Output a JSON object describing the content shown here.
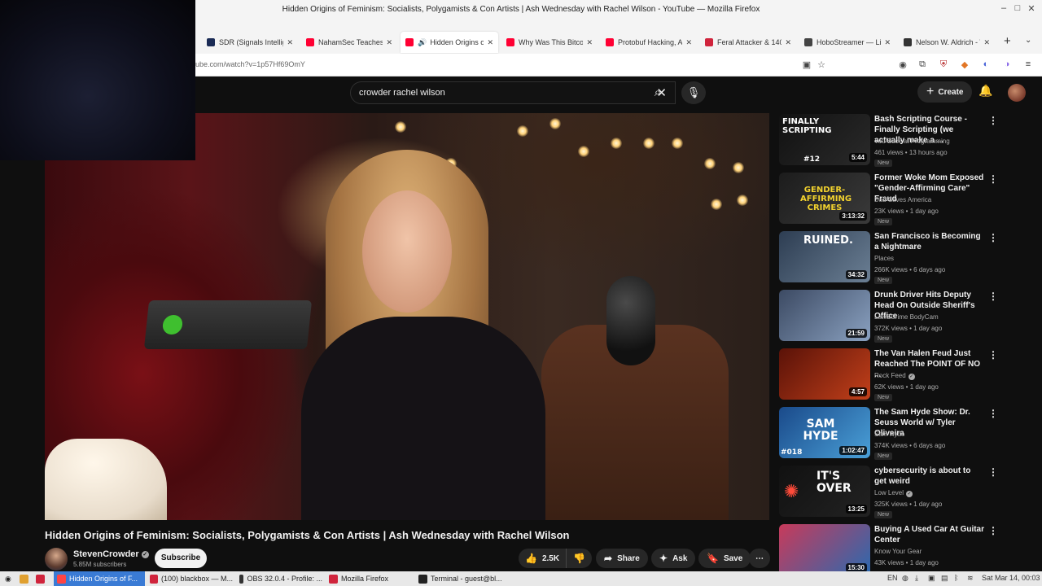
{
  "window": {
    "title": "Hidden Origins of Feminism: Socialists, Polygamists & Con Artists | Ash Wednesday with Rachel Wilson - YouTube — Mozilla Firefox",
    "controls": [
      "–",
      "□",
      "✕"
    ]
  },
  "tabs": [
    {
      "label": "SDR (Signals Intellige",
      "favicon_color": "#1a2b55",
      "active": false
    },
    {
      "label": "NahamSec Teaches M",
      "favicon_color": "#ff0033",
      "active": false
    },
    {
      "label": "Hidden Origins of",
      "favicon_color": "#ff0033",
      "active": true
    },
    {
      "label": "Why Was This Bitcoin",
      "favicon_color": "#ff0033",
      "active": false
    },
    {
      "label": "Protobuf Hacking, AI",
      "favicon_color": "#ff0033",
      "active": false
    },
    {
      "label": "Feral Attacker & 140",
      "favicon_color": "#d0243c",
      "active": false
    },
    {
      "label": "HoboStreamer — Liv",
      "favicon_color": "#444444",
      "active": false
    },
    {
      "label": "Nelson W. Aldrich - W",
      "favicon_color": "#333333",
      "active": false
    }
  ],
  "new_tab": "+",
  "url": "ube.com/watch?v=1p57Hf69OmY",
  "youtube": {
    "search_value": "crowder rachel wilson",
    "create_label": "Create",
    "video": {
      "title": "Hidden Origins of Feminism: Socialists, Polygamists & Con Artists | Ash Wednesday with Rachel Wilson",
      "channel": "StevenCrowder",
      "subscribers": "5.85M subscribers",
      "subscribe_label": "Subscribe",
      "likes": "2.5K",
      "share_label": "Share",
      "ask_label": "Ask",
      "save_label": "Save"
    },
    "recommendations": [
      {
        "title": "Bash Scripting Course - Finally Scripting (we actually make a ...",
        "channel": "You Suck at Programming",
        "verified": false,
        "meta": "461 views • 13 hours ago",
        "badge": "New",
        "duration": "5:44",
        "thumb_text": "FINALLY SCRIPTING",
        "thumb_sub": "#12",
        "thumb_colors": [
          "#111111",
          "#2a2a2a"
        ]
      },
      {
        "title": "Former Woke Mom Exposed \"Gender-Affirming Care\" Fraud",
        "channel": "Dad Saves America",
        "verified": false,
        "meta": "23K views • 1 day ago",
        "badge": "New",
        "duration": "3:13:32",
        "thumb_text": "GENDER-AFFIRMING CRIMES",
        "thumb_sub": "",
        "thumb_colors": [
          "#1c1c1c",
          "#3a3a3a"
        ]
      },
      {
        "title": "San Francisco is Becoming a Nightmare",
        "channel": "Places",
        "verified": false,
        "meta": "266K views • 6 days ago",
        "badge": "New",
        "duration": "34:32",
        "thumb_text": "RUINED.",
        "thumb_sub": "",
        "thumb_colors": [
          "#2d3d52",
          "#6b7f94"
        ]
      },
      {
        "title": "Drunk Driver Hits Deputy Head On Outside Sheriff's Office",
        "channel": "Law&Crime BodyCam",
        "verified": false,
        "meta": "372K views • 1 day ago",
        "badge": "New",
        "duration": "21:59",
        "thumb_text": "",
        "thumb_sub": "",
        "thumb_colors": [
          "#3c4a63",
          "#8aa1c0"
        ]
      },
      {
        "title": "The Van Halen Feud Just Reached The POINT OF NO ...",
        "channel": "Rock Feed",
        "verified": true,
        "meta": "62K views • 1 day ago",
        "badge": "New",
        "duration": "4:57",
        "thumb_text": "",
        "thumb_sub": "",
        "thumb_colors": [
          "#5a1208",
          "#c2401a"
        ]
      },
      {
        "title": "The Sam Hyde Show: Dr. Seuss World w/ Tyler Oliveira",
        "channel": "Sam Hyde",
        "verified": false,
        "meta": "374K views • 6 days ago",
        "badge": "New",
        "duration": "1:02:47",
        "thumb_text": "SAM HYDE",
        "thumb_sub": "#018",
        "thumb_colors": [
          "#1a4a8a",
          "#4aa0d8"
        ]
      },
      {
        "title": "cybersecurity is about to get weird",
        "channel": "Low Level",
        "verified": true,
        "meta": "325K views • 1 day ago",
        "badge": "New",
        "duration": "13:25",
        "thumb_text": "IT'S OVER",
        "thumb_sub": "",
        "thumb_colors": [
          "#111111",
          "#222222"
        ]
      },
      {
        "title": "Buying A Used Car At Guitar Center",
        "channel": "Know Your Gear",
        "verified": false,
        "meta": "43K views • 1 day ago",
        "badge": "",
        "duration": "15:30",
        "thumb_text": "",
        "thumb_sub": "",
        "thumb_colors": [
          "#c83a5a",
          "#2a6ab0"
        ]
      }
    ]
  },
  "taskbar": {
    "items": [
      {
        "label": "Hidden Origins of F...",
        "active": true,
        "icon_color": "#ff4444"
      },
      {
        "label": "(100) blackbox — M...",
        "active": false,
        "icon_color": "#d0243c"
      },
      {
        "label": "OBS 32.0.4 - Profile: ...",
        "active": false,
        "icon_color": "#333333"
      },
      {
        "label": "Mozilla Firefox",
        "active": false,
        "icon_color": "#d0243c"
      },
      {
        "label": "Terminal - guest@bl...",
        "active": false,
        "icon_color": "#222222"
      }
    ],
    "lang": "EN",
    "clock": "Sat Mar 14, 00:03"
  }
}
